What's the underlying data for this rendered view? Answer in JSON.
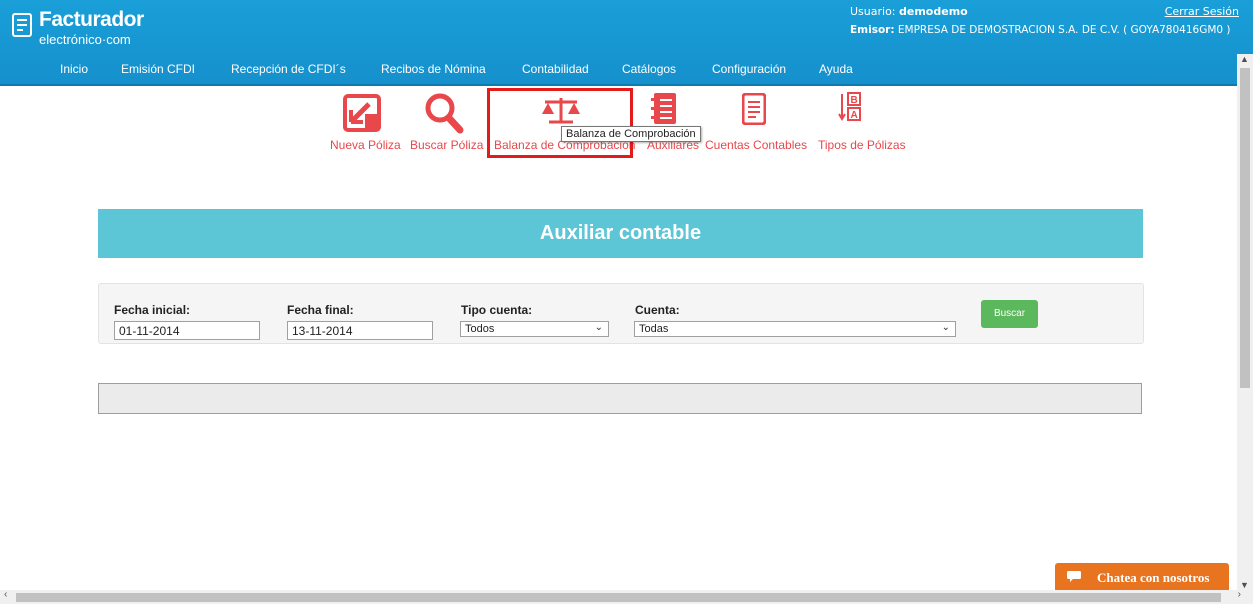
{
  "header": {
    "logo_title": "Facturador",
    "logo_sub": "electrónico·com",
    "user_label": "Usuario:",
    "user_name": "demodemo",
    "emisor_label": "Emisor:",
    "emisor_value": "EMPRESA DE DEMOSTRACION S.A. DE C.V. ( GOYA780416GM0 )",
    "logout": "Cerrar Sesión"
  },
  "nav": {
    "items": [
      "Inicio",
      "Emisión CFDI",
      "Recepción de CFDI´s",
      "Recibos de Nómina",
      "Contabilidad",
      "Catálogos",
      "Configuración",
      "Ayuda"
    ]
  },
  "toolbar": {
    "items": [
      {
        "label": "Nueva Póliza",
        "icon": "new-policy-icon"
      },
      {
        "label": "Buscar Póliza",
        "icon": "search-icon"
      },
      {
        "label": "Balanza de Comprobación",
        "icon": "scale-icon"
      },
      {
        "label": "Auxiliares",
        "icon": "ledger-icon"
      },
      {
        "label": "Cuentas Contables",
        "icon": "accounts-icon"
      },
      {
        "label": "Tipos de Pólizas",
        "icon": "sort-az-icon"
      }
    ],
    "tooltip": "Balanza de Comprobación"
  },
  "page": {
    "title": "Auxiliar contable"
  },
  "filters": {
    "fecha_inicial_label": "Fecha inicial:",
    "fecha_inicial_value": "01-11-2014",
    "fecha_final_label": "Fecha final:",
    "fecha_final_value": "13-11-2014",
    "tipo_cuenta_label": "Tipo cuenta:",
    "tipo_cuenta_value": "Todos",
    "cuenta_label": "Cuenta:",
    "cuenta_value": "Todas",
    "buscar_label": "Buscar"
  },
  "chat": {
    "label": "Chatea con nosotros"
  },
  "colors": {
    "header": "#1a9fd8",
    "accent_red": "#e8474b",
    "banner": "#5dc6d6",
    "button_green": "#5cb85c",
    "chat_orange": "#e8741f",
    "highlight": "#e41b1b"
  }
}
